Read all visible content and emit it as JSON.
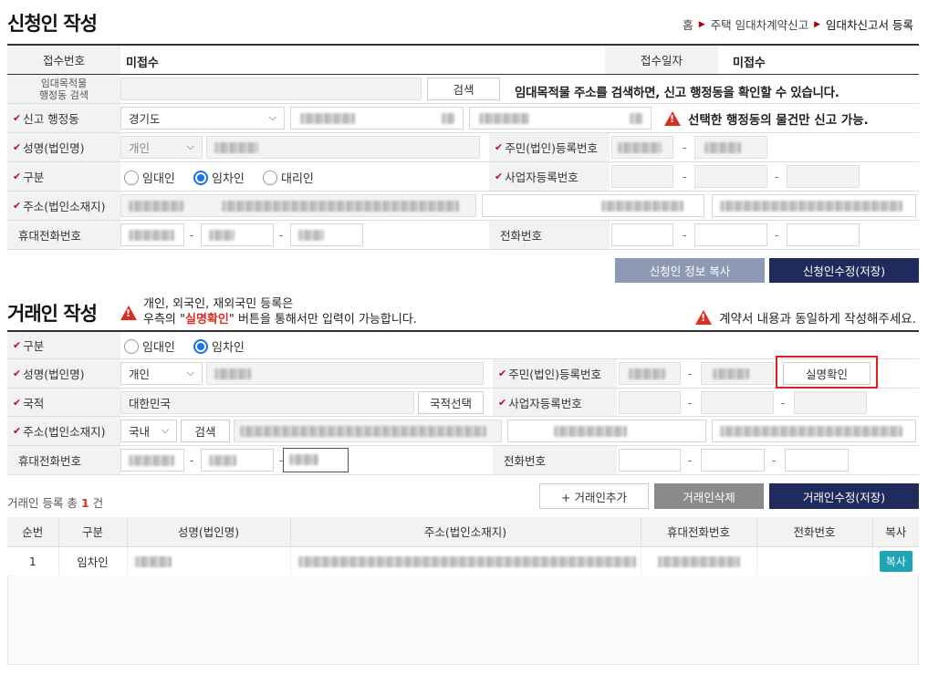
{
  "title": "신청인 작성",
  "breadcrumb": {
    "home": "홈",
    "item1": "주택 임대차계약신고",
    "item2": "임대차신고서 등록"
  },
  "applicant": {
    "receipt_no_label": "접수번호",
    "receipt_no": "미접수",
    "receipt_date_label": "접수일자",
    "receipt_date": "미접수",
    "search_label": "임대목적물\n행정동 검색",
    "search_button": "검색",
    "search_note": "임대목적물 주소를 검색하면, 신고 행정동을 확인할 수 있습니다.",
    "district_label": "신고 행정동",
    "province": "경기도",
    "district_warning": "선택한 행정동의 물건만 신고 가능.",
    "name_label": "성명(법인명)",
    "person_type": "개인",
    "id_label": "주민(법인)등록번호",
    "type_label": "구분",
    "radio_landlord": "임대인",
    "radio_tenant": "임차인",
    "radio_agent": "대리인",
    "biz_label": "사업자등록번호",
    "address_label": "주소(법인소재지)",
    "mobile_label": "휴대전화번호",
    "phone_label": "전화번호",
    "copy_button": "신청인 정보 복사",
    "save_button": "신청인수정(저장)"
  },
  "counterparty": {
    "title": "거래인 작성",
    "note_line1": "개인, 외국인, 재외국민 등록은",
    "note_line2_pre": "우측의 \"",
    "note_line2_red": "실명확인",
    "note_line2_post": "\" 버튼을 통해서만 입력이 가능합니다.",
    "right_warning": "계약서 내용과 동일하게 작성해주세요.",
    "type_label": "구분",
    "radio_landlord": "임대인",
    "radio_tenant": "임차인",
    "name_label": "성명(법인명)",
    "person_type": "개인",
    "id_label": "주민(법인)등록번호",
    "verify_button": "실명확인",
    "nation_label": "국적",
    "nation": "대한민국",
    "nation_button": "국적선택",
    "biz_label": "사업자등록번호",
    "address_label": "주소(법인소재지)",
    "domestic": "국내",
    "search_button": "검색",
    "mobile_label": "휴대전화번호",
    "phone_label": "전화번호"
  },
  "registry": {
    "count_prefix": "거래인 등록 총",
    "count": "1",
    "count_suffix": "건",
    "add_button": "+ 거래인추가",
    "delete_button": "거래인삭제",
    "save_button": "거래인수정(저장)",
    "columns": [
      "순번",
      "구분",
      "성명(법인명)",
      "주소(법인소재지)",
      "휴대전화번호",
      "전화번호",
      "복사"
    ],
    "rows": [
      {
        "no": "1",
        "type": "임차인",
        "copy": "복사"
      }
    ]
  },
  "colors": {
    "navy": "#1f2b5c",
    "red": "#d93025",
    "teal": "#1fa3b5",
    "highlight": "#e02020"
  }
}
